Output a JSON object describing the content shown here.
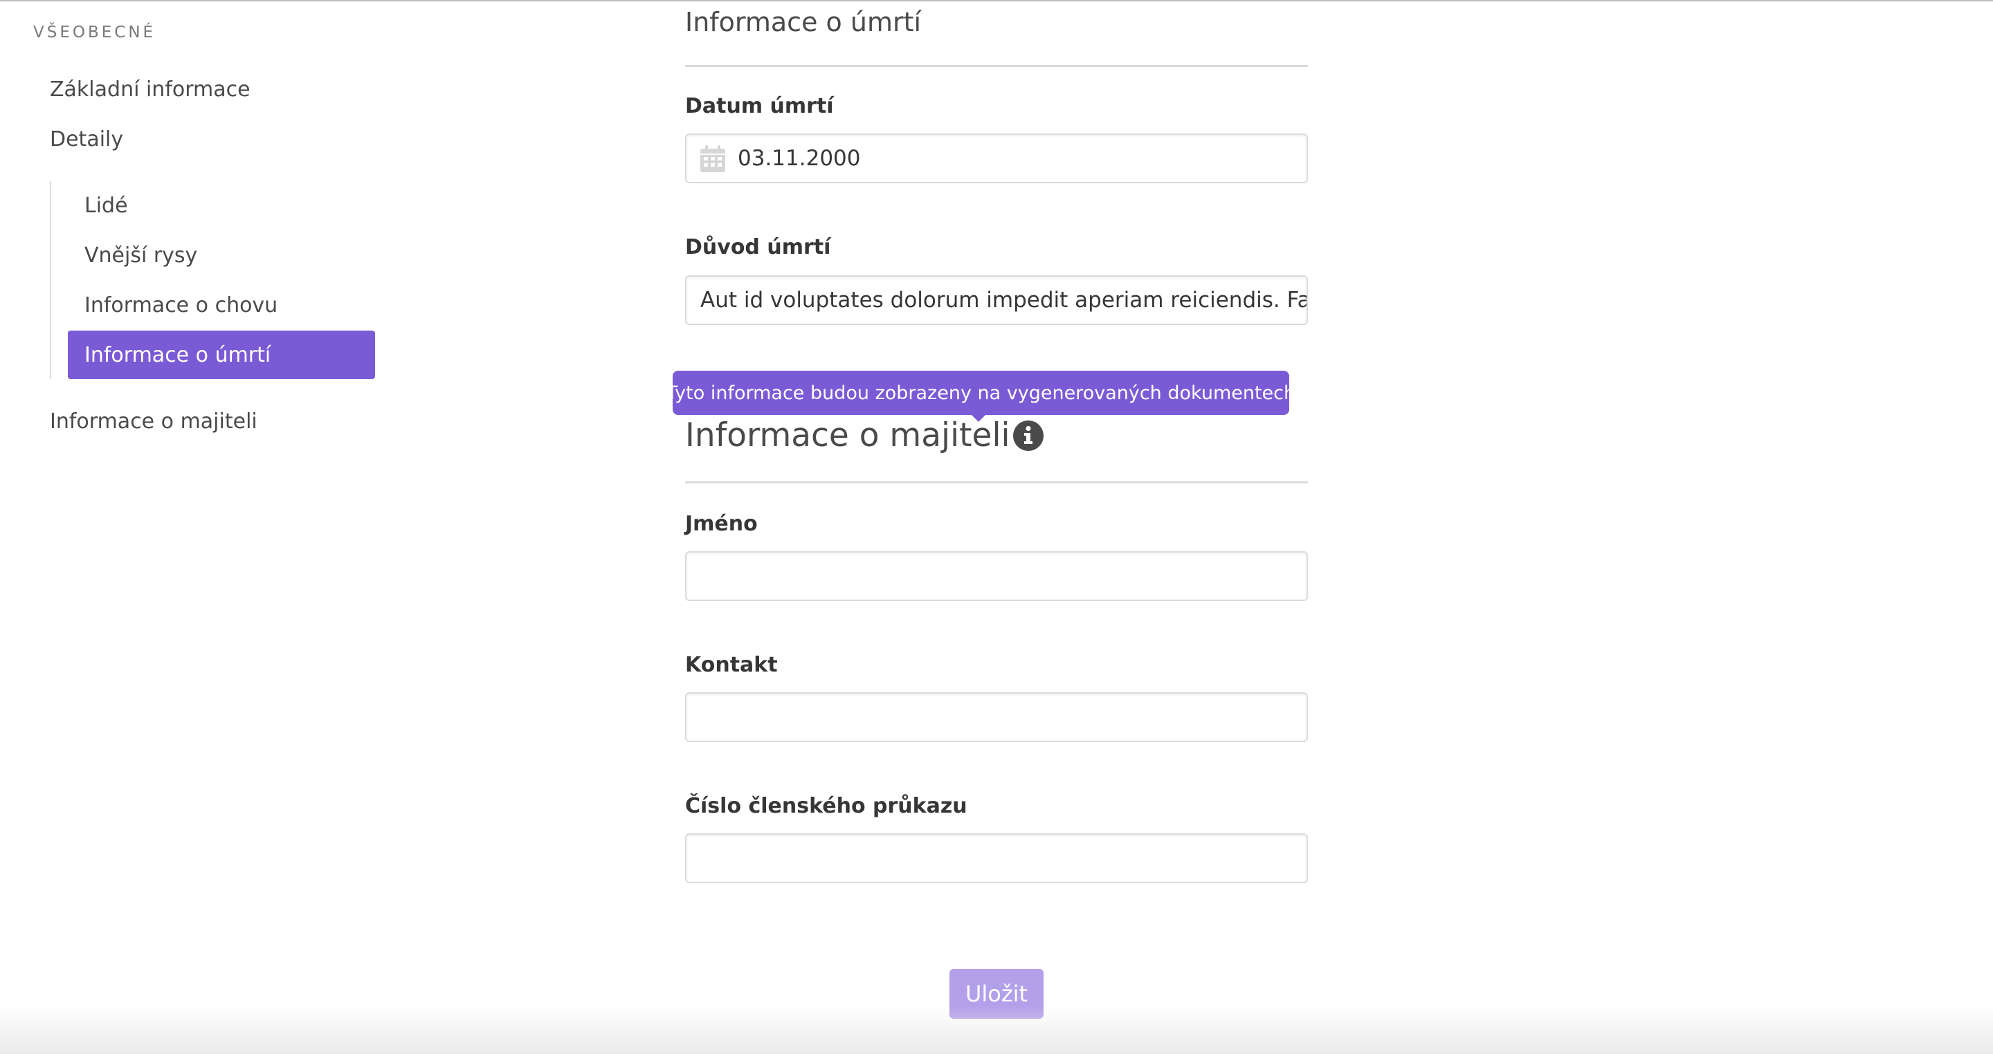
{
  "sidebar": {
    "section_label": "VŠEOBECNÉ",
    "items": {
      "basic": "Základní informace",
      "details": "Detaily",
      "owner": "Informace o majiteli"
    },
    "subitems": [
      "Lidé",
      "Vnější rysy",
      "Informace o chovu",
      "Informace o úmrtí"
    ],
    "active_subitem": "Informace o úmrtí"
  },
  "form": {
    "death_section": {
      "title": "Informace o úmrtí",
      "date_label": "Datum úmrtí",
      "date_value": "03.11.2000",
      "reason_label": "Důvod úmrtí",
      "reason_value": "Aut id voluptates dolorum impedit aperiam reiciendis. Facere"
    },
    "owner_section": {
      "title": "Informace o majiteli",
      "tooltip": "Tyto informace budou zobrazeny na vygenerovaných dokumentech",
      "name_label": "Jméno",
      "name_value": "",
      "contact_label": "Kontakt",
      "contact_value": "",
      "card_label": "Číslo členského průkazu",
      "card_value": ""
    },
    "save_label": "Uložit"
  },
  "colors": {
    "accent": "#7b5ad6",
    "accent_disabled": "#b3a0ea",
    "border": "#dbdbdb"
  },
  "icons": [
    "calendar-icon",
    "info-icon"
  ]
}
